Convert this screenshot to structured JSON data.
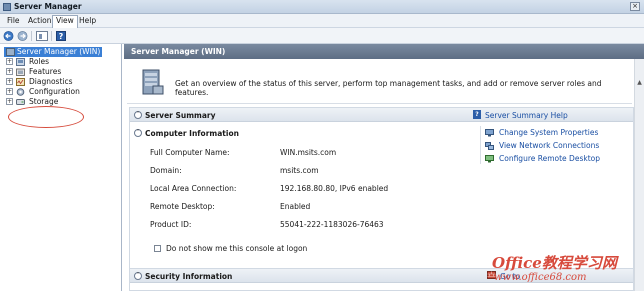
{
  "window": {
    "title": "Server Manager",
    "close_glyph": "×"
  },
  "menu": [
    {
      "label": "File"
    },
    {
      "label": "Action"
    },
    {
      "label": "View"
    },
    {
      "label": "Help"
    }
  ],
  "toolbar": {
    "help_glyph": "?"
  },
  "tree": {
    "root": "Server Manager (WIN)",
    "items": [
      {
        "label": "Roles",
        "icon": "roles-icon"
      },
      {
        "label": "Features",
        "icon": "features-icon"
      },
      {
        "label": "Diagnostics",
        "icon": "diagnostics-icon"
      },
      {
        "label": "Configuration",
        "icon": "configuration-icon"
      },
      {
        "label": "Storage",
        "icon": "storage-icon"
      }
    ],
    "expand_glyph": "+"
  },
  "main": {
    "header": "Server Manager (WIN)",
    "banner_text": "Get an overview of the status of this server, perform top management tasks, and add or remove server roles and features.",
    "server_summary": {
      "title": "Server Summary",
      "help_link": "Server Summary Help",
      "computer_info": {
        "title": "Computer Information",
        "rows": [
          {
            "label": "Full Computer Name:",
            "value": "WIN.msits.com"
          },
          {
            "label": "Domain:",
            "value": "msits.com"
          },
          {
            "label": "Local Area Connection:",
            "value": "192.168.80.80, IPv6 enabled"
          },
          {
            "label": "Remote Desktop:",
            "value": "Enabled"
          },
          {
            "label": "Product ID:",
            "value": "55041-222-1183026-76463"
          }
        ],
        "actions": [
          {
            "label": "Change System Properties"
          },
          {
            "label": "View Network Connections"
          },
          {
            "label": "Configure Remote Desktop"
          }
        ],
        "checkbox_label": "Do not show me this console at logon"
      }
    },
    "security_info": {
      "title": "Security Information",
      "goto": "Go to"
    }
  },
  "watermark": {
    "line1": "Office教程学习网",
    "line2": "www.office68.com"
  },
  "colors": {
    "selection": "#3a7fd5",
    "header": "#6b7b92",
    "link": "#1a4fa3",
    "annotation": "#d64b3c"
  }
}
